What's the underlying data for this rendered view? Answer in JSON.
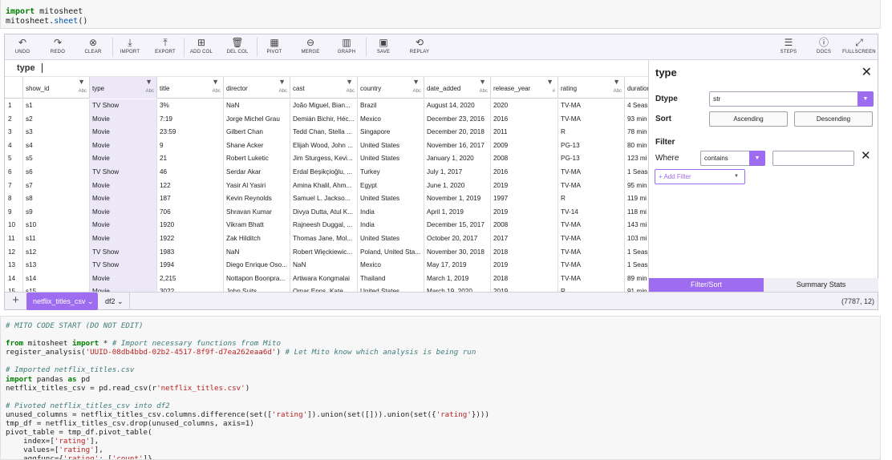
{
  "top_cell": {
    "line1_kw": "import",
    "line1_rest": " mitosheet",
    "line2_obj": "mitosheet.",
    "line2_fn": "sheet",
    "line2_end": "()"
  },
  "toolbar": {
    "left": [
      {
        "label": "UNDO",
        "icon": "undo-icon",
        "glyph": "↶"
      },
      {
        "label": "REDO",
        "icon": "redo-icon",
        "glyph": "↷"
      },
      {
        "label": "CLEAR",
        "icon": "clear-icon",
        "glyph": "⊗"
      },
      {
        "label": "IMPORT",
        "icon": "import-icon",
        "glyph": "⤓"
      },
      {
        "label": "EXPORT",
        "icon": "export-icon",
        "glyph": "⤒"
      },
      {
        "label": "ADD COL",
        "icon": "add-column-icon",
        "glyph": "⊞"
      },
      {
        "label": "DEL COL",
        "icon": "trash-icon",
        "glyph": "🗑"
      },
      {
        "label": "PIVOT",
        "icon": "pivot-icon",
        "glyph": "▦"
      },
      {
        "label": "MERGE",
        "icon": "merge-icon",
        "glyph": "⊖"
      },
      {
        "label": "GRAPH",
        "icon": "graph-icon",
        "glyph": "▥"
      },
      {
        "label": "SAVE",
        "icon": "save-icon",
        "glyph": "▣"
      },
      {
        "label": "REPLAY",
        "icon": "replay-icon",
        "glyph": "⟲"
      }
    ],
    "right": [
      {
        "label": "STEPS",
        "icon": "steps-icon",
        "glyph": "☰"
      },
      {
        "label": "DOCS",
        "icon": "help-icon",
        "glyph": "ⓘ"
      },
      {
        "label": "FULLSCREEN",
        "icon": "fullscreen-icon",
        "glyph": "⤢"
      }
    ]
  },
  "formula_bar": {
    "column": "type"
  },
  "columns": [
    {
      "name": "show_id",
      "dtype": "Abc"
    },
    {
      "name": "type",
      "dtype": "Abc"
    },
    {
      "name": "title",
      "dtype": "Abc"
    },
    {
      "name": "director",
      "dtype": "Abc"
    },
    {
      "name": "cast",
      "dtype": "Abc"
    },
    {
      "name": "country",
      "dtype": "Abc"
    },
    {
      "name": "date_added",
      "dtype": "Abc"
    },
    {
      "name": "release_year",
      "dtype": "#"
    },
    {
      "name": "rating",
      "dtype": "Abc"
    },
    {
      "name": "duration",
      "dtype": ""
    }
  ],
  "rows": [
    [
      "1",
      "s1",
      "TV Show",
      "3%",
      "NaN",
      "João Miguel, Bian...",
      "Brazil",
      "August 14, 2020",
      "2020",
      "TV-MA",
      "4 Seas"
    ],
    [
      "2",
      "s2",
      "Movie",
      "7:19",
      "Jorge Michel Grau",
      "Demián Bichir, Héc...",
      "Mexico",
      "December 23, 2016",
      "2016",
      "TV-MA",
      "93 min"
    ],
    [
      "3",
      "s3",
      "Movie",
      "23:59",
      "Gilbert Chan",
      "Tedd Chan, Stella ...",
      "Singapore",
      "December 20, 2018",
      "2011",
      "R",
      "78 min"
    ],
    [
      "4",
      "s4",
      "Movie",
      "9",
      "Shane Acker",
      "Elijah Wood, John ...",
      "United States",
      "November 16, 2017",
      "2009",
      "PG-13",
      "80 min"
    ],
    [
      "5",
      "s5",
      "Movie",
      "21",
      "Robert Luketic",
      "Jim Sturgess, Kevi...",
      "United States",
      "January 1, 2020",
      "2008",
      "PG-13",
      "123 mi"
    ],
    [
      "6",
      "s6",
      "TV Show",
      "46",
      "Serdar Akar",
      "Erdal Beşikçioğlu, ...",
      "Turkey",
      "July 1, 2017",
      "2016",
      "TV-MA",
      "1 Seas"
    ],
    [
      "7",
      "s7",
      "Movie",
      "122",
      "Yasir Al Yasiri",
      "Amina Khalil, Ahm...",
      "Egypt",
      "June 1, 2020",
      "2019",
      "TV-MA",
      "95 min"
    ],
    [
      "8",
      "s8",
      "Movie",
      "187",
      "Kevin Reynolds",
      "Samuel L. Jackso...",
      "United States",
      "November 1, 2019",
      "1997",
      "R",
      "119 mi"
    ],
    [
      "9",
      "s9",
      "Movie",
      "706",
      "Shravan Kumar",
      "Divya Dutta, Atul K...",
      "India",
      "April 1, 2019",
      "2019",
      "TV-14",
      "118 mi"
    ],
    [
      "10",
      "s10",
      "Movie",
      "1920",
      "Vikram Bhatt",
      "Rajneesh Duggal, ...",
      "India",
      "December 15, 2017",
      "2008",
      "TV-MA",
      "143 mi"
    ],
    [
      "11",
      "s11",
      "Movie",
      "1922",
      "Zak Hilditch",
      "Thomas Jane, Mol...",
      "United States",
      "October 20, 2017",
      "2017",
      "TV-MA",
      "103 mi"
    ],
    [
      "12",
      "s12",
      "TV Show",
      "1983",
      "NaN",
      "Robert Więckiewic...",
      "Poland, United Sta...",
      "November 30, 2018",
      "2018",
      "TV-MA",
      "1 Seas"
    ],
    [
      "13",
      "s13",
      "TV Show",
      "1994",
      "Diego Enrique Oso...",
      "NaN",
      "Mexico",
      "May 17, 2019",
      "2019",
      "TV-MA",
      "1 Seas"
    ],
    [
      "14",
      "s14",
      "Movie",
      "2,215",
      "Nottapon Boonpra...",
      "Artiwara Kongmalai",
      "Thailand",
      "March 1, 2019",
      "2018",
      "TV-MA",
      "89 min"
    ],
    [
      "15",
      "s15",
      "Movie",
      "3022",
      "John Suits",
      "Omar Epps, Kate ...",
      "United States",
      "March 19, 2020",
      "2019",
      "R",
      "91 min"
    ]
  ],
  "tabs": {
    "add_glyph": "+",
    "sheets": [
      {
        "label": "netflix_titles_csv ⌄"
      },
      {
        "label": "df2 ⌄"
      }
    ],
    "shape": "(7787, 12)"
  },
  "panel": {
    "title": "type",
    "close": "✕",
    "dtype_label": "Dtype",
    "dtype_value": "str",
    "sort_label": "Sort",
    "asc": "Ascending",
    "desc": "Descending",
    "filter_label": "Filter",
    "where_label": "Where",
    "condition": "contains",
    "delete": "✕",
    "add_filter": "+ Add Filter",
    "tab_filter": "Filter/Sort",
    "tab_summary": "Summary Stats"
  },
  "code_lines": [
    [
      {
        "t": "# MITO CODE START (DO NOT EDIT)",
        "c": "cm"
      }
    ],
    [],
    [
      {
        "t": "from",
        "c": "kw"
      },
      {
        "t": " mitosheet "
      },
      {
        "t": "import",
        "c": "kw"
      },
      {
        "t": " * "
      },
      {
        "t": "# Import necessary functions from Mito",
        "c": "cm"
      }
    ],
    [
      {
        "t": "register_analysis("
      },
      {
        "t": "'UUID-08db4bbd-02b2-4517-8f9f-d7ea262eaa6d'",
        "c": "str"
      },
      {
        "t": ") "
      },
      {
        "t": "# Let Mito know which analysis is being run",
        "c": "cm"
      }
    ],
    [],
    [
      {
        "t": "# Imported netflix_titles.csv",
        "c": "cm"
      }
    ],
    [
      {
        "t": "import",
        "c": "kw"
      },
      {
        "t": " pandas "
      },
      {
        "t": "as",
        "c": "kw"
      },
      {
        "t": " pd"
      }
    ],
    [
      {
        "t": "netflix_titles_csv = pd.read_csv(r"
      },
      {
        "t": "'netflix_titles.csv'",
        "c": "str"
      },
      {
        "t": ")"
      }
    ],
    [],
    [
      {
        "t": "# Pivoted netflix_titles_csv into df2",
        "c": "cm"
      }
    ],
    [
      {
        "t": "unused_columns = netflix_titles_csv.columns.difference(set(["
      },
      {
        "t": "'rating'",
        "c": "str"
      },
      {
        "t": "]).union(set([])).union(set({"
      },
      {
        "t": "'rating'",
        "c": "str"
      },
      {
        "t": "})))"
      }
    ],
    [
      {
        "t": "tmp_df = netflix_titles_csv.drop(unused_columns, axis=1)"
      }
    ],
    [
      {
        "t": "pivot_table = tmp_df.pivot_table("
      }
    ],
    [
      {
        "t": "    index=["
      },
      {
        "t": "'rating'",
        "c": "str"
      },
      {
        "t": "],"
      }
    ],
    [
      {
        "t": "    values=["
      },
      {
        "t": "'rating'",
        "c": "str"
      },
      {
        "t": "],"
      }
    ],
    [
      {
        "t": "    aggfunc={"
      },
      {
        "t": "'rating'",
        "c": "str"
      },
      {
        "t": ": ["
      },
      {
        "t": "'count'",
        "c": "str"
      },
      {
        "t": "]}"
      }
    ]
  ]
}
